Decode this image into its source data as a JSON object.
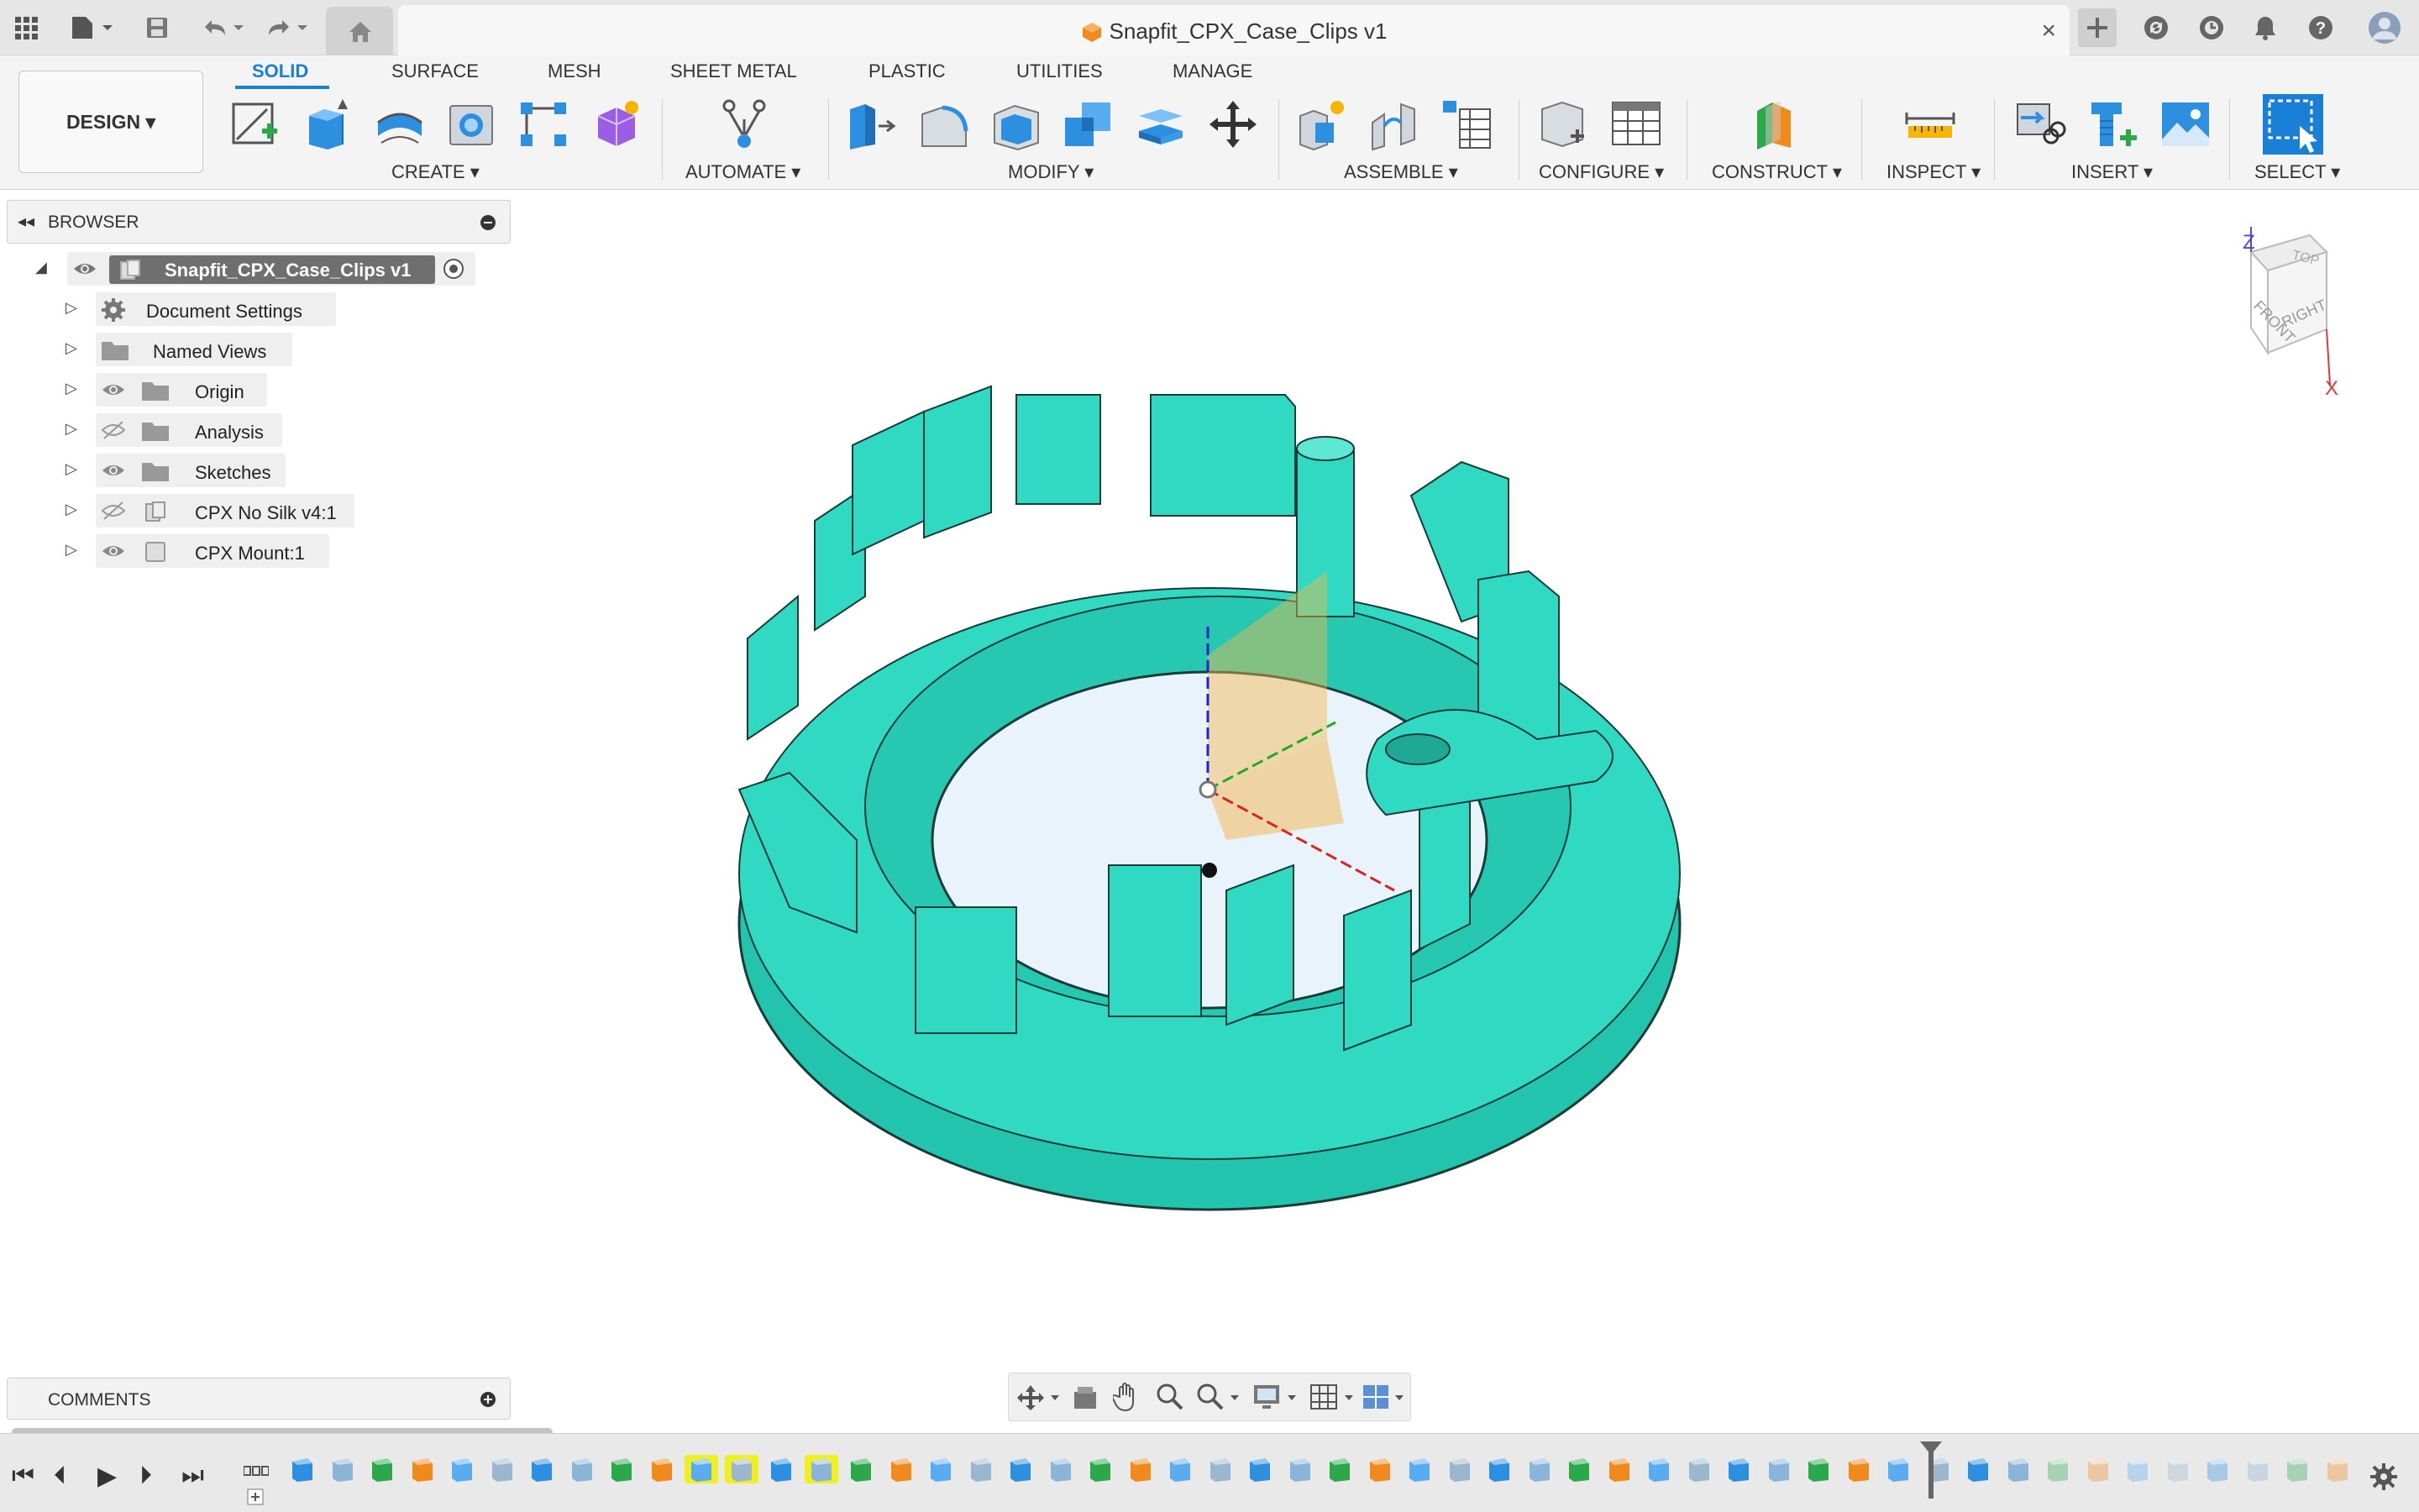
{
  "app": {
    "document_title": "Snapfit_CPX_Case_Clips v1",
    "close_glyph": "×",
    "accent": "#1a7fd6",
    "model_color": "#2fd9c2"
  },
  "workspace": {
    "design_label": "DESIGN ▾",
    "tabs": [
      "SOLID",
      "SURFACE",
      "MESH",
      "SHEET METAL",
      "PLASTIC",
      "UTILITIES",
      "MANAGE"
    ],
    "groups": {
      "create": "CREATE ▾",
      "automate": "AUTOMATE ▾",
      "modify": "MODIFY ▾",
      "assemble": "ASSEMBLE ▾",
      "configure": "CONFIGURE ▾",
      "construct": "CONSTRUCT ▾",
      "inspect": "INSPECT ▾",
      "insert": "INSERT ▾",
      "select": "SELECT ▾"
    }
  },
  "browser": {
    "title": "BROWSER",
    "root": "Snapfit_CPX_Case_Clips v1",
    "items": [
      {
        "label": "Document Settings",
        "icon": "gear-icon",
        "eye": "none"
      },
      {
        "label": "Named Views",
        "icon": "folder-icon",
        "eye": "none"
      },
      {
        "label": "Origin",
        "icon": "folder-icon",
        "eye": "visible"
      },
      {
        "label": "Analysis",
        "icon": "folder-icon",
        "eye": "hidden"
      },
      {
        "label": "Sketches",
        "icon": "folder-icon",
        "eye": "visible"
      },
      {
        "label": "CPX No Silk v4:1",
        "icon": "component-icon",
        "eye": "hidden"
      },
      {
        "label": "CPX Mount:1",
        "icon": "component-icon",
        "eye": "visible"
      }
    ]
  },
  "comments": {
    "title": "COMMENTS"
  },
  "viewcube": {
    "top": "TOP",
    "front": "FRONT",
    "right": "RIGHT",
    "z": "Z",
    "x": "X"
  }
}
